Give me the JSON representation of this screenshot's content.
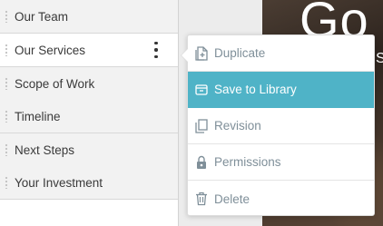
{
  "sections": [
    {
      "label": "Our Team",
      "active": false
    },
    {
      "label": "Our Services",
      "active": true
    },
    {
      "label": "Scope of Work",
      "active": false
    },
    {
      "label": "Timeline",
      "active": false
    },
    {
      "label": "Next Steps",
      "active": false
    },
    {
      "label": "Your Investment",
      "active": false
    }
  ],
  "hero": {
    "title_fragment": "Go",
    "subtitle_fragment": "S"
  },
  "context_menu": {
    "items": [
      {
        "label": "Duplicate",
        "icon": "duplicate-icon",
        "highlighted": false
      },
      {
        "label": "Save to Library",
        "icon": "library-icon",
        "highlighted": true
      },
      {
        "label": "Revision",
        "icon": "revision-icon",
        "highlighted": false
      },
      {
        "label": "Permissions",
        "icon": "lock-icon",
        "highlighted": false
      },
      {
        "label": "Delete",
        "icon": "trash-icon",
        "highlighted": false
      }
    ]
  },
  "colors": {
    "highlight": "#4fb3c7",
    "menu_text": "#7f8f99",
    "row_bg": "#f2f2f2",
    "active_row_bg": "#ffffff"
  }
}
